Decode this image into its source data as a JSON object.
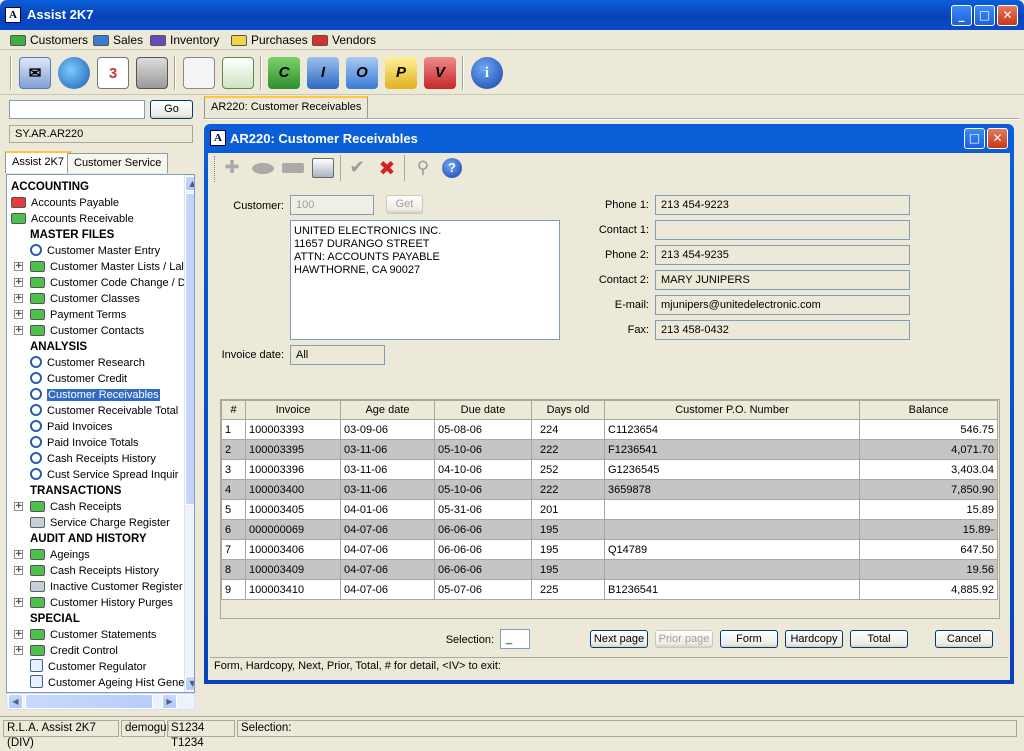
{
  "app": {
    "title": "Assist 2K7",
    "logo_glyph": "A"
  },
  "menus": [
    {
      "label": "Customers",
      "color": "#3fae3f"
    },
    {
      "label": "Sales",
      "color": "#3b7bd4"
    },
    {
      "label": "Inventory",
      "color": "#6b48b8"
    },
    {
      "label": "Purchases",
      "color": "#f2d34a"
    },
    {
      "label": "Vendors",
      "color": "#d93030"
    }
  ],
  "toolbar": {
    "icons": [
      "mail-icon",
      "globe-icon",
      "calendar-icon",
      "calculator-icon",
      "report-icon",
      "spreadsheet-icon",
      "c-icon",
      "i-icon",
      "o-icon",
      "p-icon",
      "v-icon",
      "info-icon"
    ],
    "letters": {
      "c": "C",
      "i": "I",
      "o": "O",
      "p": "P",
      "v": "V",
      "info": "i"
    }
  },
  "sidebar": {
    "search_value": "",
    "go_label": "Go",
    "program_code": "SY.AR.AR220",
    "tabs": [
      "Assist 2K7",
      "Customer Service"
    ],
    "tree": [
      {
        "label": "ACCOUNTING",
        "kind": "header"
      },
      {
        "label": "Accounts Payable",
        "kind": "red"
      },
      {
        "label": "Accounts Receivable",
        "kind": "green"
      },
      {
        "label": "MASTER FILES",
        "kind": "subheader"
      },
      {
        "label": "Customer Master Entry",
        "kind": "item"
      },
      {
        "label": "Customer Master Lists / Lal",
        "kind": "folder"
      },
      {
        "label": "Customer Code Change / D",
        "kind": "folder"
      },
      {
        "label": "Customer Classes",
        "kind": "folder"
      },
      {
        "label": "Payment Terms",
        "kind": "folder"
      },
      {
        "label": "Customer Contacts",
        "kind": "folder"
      },
      {
        "label": "ANALYSIS",
        "kind": "subheader"
      },
      {
        "label": "Customer Research",
        "kind": "mag"
      },
      {
        "label": "Customer Credit",
        "kind": "mag"
      },
      {
        "label": "Customer Receivables",
        "kind": "mag",
        "selected": true
      },
      {
        "label": "Customer Receivable Total",
        "kind": "mag"
      },
      {
        "label": "Paid Invoices",
        "kind": "mag"
      },
      {
        "label": "Paid Invoice Totals",
        "kind": "mag"
      },
      {
        "label": "Cash Receipts History",
        "kind": "mag"
      },
      {
        "label": "Cust Service Spread Inquir",
        "kind": "mag"
      },
      {
        "label": "TRANSACTIONS",
        "kind": "subheader"
      },
      {
        "label": "Cash Receipts",
        "kind": "folder"
      },
      {
        "label": "Service Charge Register",
        "kind": "printer"
      },
      {
        "label": "AUDIT AND HISTORY",
        "kind": "subheader"
      },
      {
        "label": "Ageings",
        "kind": "folder"
      },
      {
        "label": "Cash Receipts History",
        "kind": "folder"
      },
      {
        "label": "Inactive Customer Register",
        "kind": "printer"
      },
      {
        "label": "Customer History Purges",
        "kind": "folder"
      },
      {
        "label": "SPECIAL",
        "kind": "subheader"
      },
      {
        "label": "Customer Statements",
        "kind": "folder"
      },
      {
        "label": "Credit Control",
        "kind": "folder"
      },
      {
        "label": "Customer Regulator",
        "kind": "doc"
      },
      {
        "label": "Customer Ageing Hist Gene",
        "kind": "doc"
      }
    ]
  },
  "doc_tab": "AR220: Customer Receivables",
  "window": {
    "title": "AR220: Customer Receivables",
    "customer_label": "Customer:",
    "customer_value": "100",
    "get_label": "Get",
    "address": "UNITED ELECTRONICS INC.\n11657 DURANGO STREET\nATTN: ACCOUNTS PAYABLE\nHAWTHORNE, CA 90027",
    "invoice_date_label": "Invoice date:",
    "invoice_date_value": "All",
    "contact_fields": [
      {
        "label": "Phone 1:",
        "value": "213 454-9223"
      },
      {
        "label": "Contact 1:",
        "value": ""
      },
      {
        "label": "Phone 2:",
        "value": "213 454-9235"
      },
      {
        "label": "Contact 2:",
        "value": "MARY JUNIPERS"
      },
      {
        "label": "E-mail:",
        "value": "mjunipers@unitedelectronic.com"
      },
      {
        "label": "Fax:",
        "value": "213 458-0432"
      }
    ],
    "table": {
      "columns": [
        "#",
        "Invoice",
        "Age date",
        "Due date",
        "Days old",
        "Customer P.O. Number",
        "Balance"
      ],
      "rows": [
        [
          "1",
          "100003393",
          "03-09-06",
          "05-08-06",
          "224",
          "C1123654",
          "546.75"
        ],
        [
          "2",
          "100003395",
          "03-11-06",
          "05-10-06",
          "222",
          "F1236541",
          "4,071.70"
        ],
        [
          "3",
          "100003396",
          "03-11-06",
          "04-10-06",
          "252",
          "G1236545",
          "3,403.04"
        ],
        [
          "4",
          "100003400",
          "03-11-06",
          "05-10-06",
          "222",
          "3659878",
          "7,850.90"
        ],
        [
          "5",
          "100003405",
          "04-01-06",
          "05-31-06",
          "201",
          "",
          "15.89"
        ],
        [
          "6",
          "000000069",
          "04-07-06",
          "06-06-06",
          "195",
          "",
          "15.89-"
        ],
        [
          "7",
          "100003406",
          "04-07-06",
          "06-06-06",
          "195",
          "Q14789",
          "647.50"
        ],
        [
          "8",
          "100003409",
          "04-07-06",
          "06-06-06",
          "195",
          "",
          "19.56"
        ],
        [
          "9",
          "100003410",
          "04-07-06",
          "05-07-06",
          "225",
          "B1236541",
          "4,885.92"
        ]
      ]
    },
    "selection_label": "Selection:",
    "selection_value": "_",
    "buttons": {
      "next": "Next page",
      "prior": "Prior page",
      "form": "Form",
      "hardcopy": "Hardcopy",
      "total": "Total",
      "cancel": "Cancel"
    },
    "hint": "Form,  Hardcopy,  Next,  Prior,  Total,  # for detail,  <IV> to exit:"
  },
  "statusbar": [
    "R.L.A. Assist 2K7 (DIV)",
    "demogui",
    "S1234 T1234",
    "Selection:"
  ]
}
